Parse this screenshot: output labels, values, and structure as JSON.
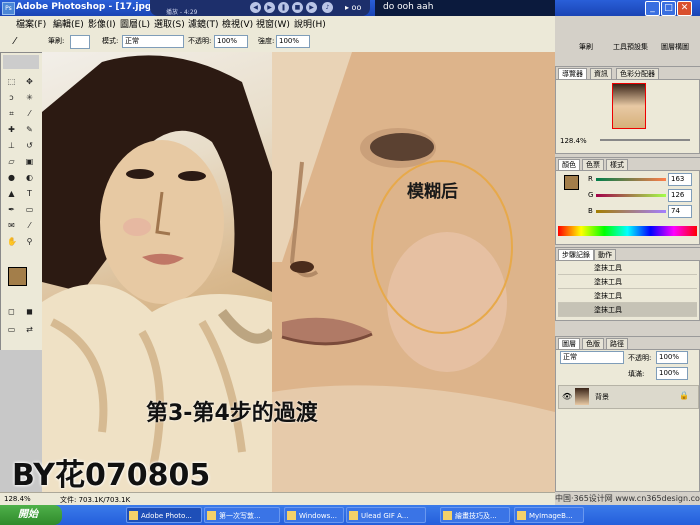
{
  "window": {
    "title": "Adobe Photoshop - [17.jpg @ 12",
    "app_icon": "Ps"
  },
  "media_player": {
    "caption": "播放 - 4:29",
    "trailing": "▸ oo"
  },
  "song_bar": {
    "label": "do  ooh aah"
  },
  "menu": {
    "items": [
      "檔案(F)",
      "編輯(E)",
      "影像(I)",
      "圖層(L)",
      "選取(S)",
      "濾鏡(T)",
      "檢視(V)",
      "視窗(W)",
      "說明(H)"
    ]
  },
  "options_bar": {
    "brush_label": "筆刷:",
    "mode_label": "模式:",
    "mode_value": "正常",
    "opacity_label": "不透明:",
    "opacity_value": "100%",
    "strength_label": "強度:",
    "strength_value": "100%"
  },
  "canvas": {
    "annotation_blur": "模糊后",
    "caption_step": "第3-第4步的過渡",
    "signature": "BY花070805"
  },
  "status_bar": {
    "zoom": "128.4%",
    "doc_info": "文件: 703.1K/703.1K"
  },
  "navigator_panel": {
    "tabs": [
      "導覽器",
      "資訊",
      "色彩分配器"
    ],
    "zoom": "128.4%"
  },
  "color_panel": {
    "tabs": [
      "顏色",
      "色票",
      "樣式"
    ],
    "r_label": "R",
    "r_value": "163",
    "g_label": "G",
    "g_value": "126",
    "b_label": "B",
    "b_value": "74",
    "swatch_color": "#a37e4a"
  },
  "history_panel": {
    "tabs": [
      "步驟記錄",
      "動作"
    ],
    "items": [
      "塗抹工具",
      "塗抹工具",
      "塗抹工具",
      "塗抹工具"
    ]
  },
  "layers_panel": {
    "tabs": [
      "圖層",
      "色版",
      "路徑"
    ],
    "mode": "正常",
    "opacity_label": "不透明:",
    "opacity_value": "100%",
    "fill_label": "填滿:",
    "fill_value": "100%",
    "layer_name": "背景"
  },
  "top_tabs": [
    "筆刷",
    "工具預設集",
    "圖層構圖"
  ],
  "taskbar": {
    "start": "開始",
    "tasks": [
      "Adobe Photo...",
      "第一次写敦...",
      "Windows...",
      "Ulead GIF A...",
      "繪畫技巧及...",
      "MyImageB..."
    ]
  },
  "watermark": "中国·365设计网 www.cn365design.com",
  "colors": {
    "taskbar_blue": "#245edb",
    "panel_bg": "#ece9d8",
    "annotation_orange": "#e7a94a"
  }
}
